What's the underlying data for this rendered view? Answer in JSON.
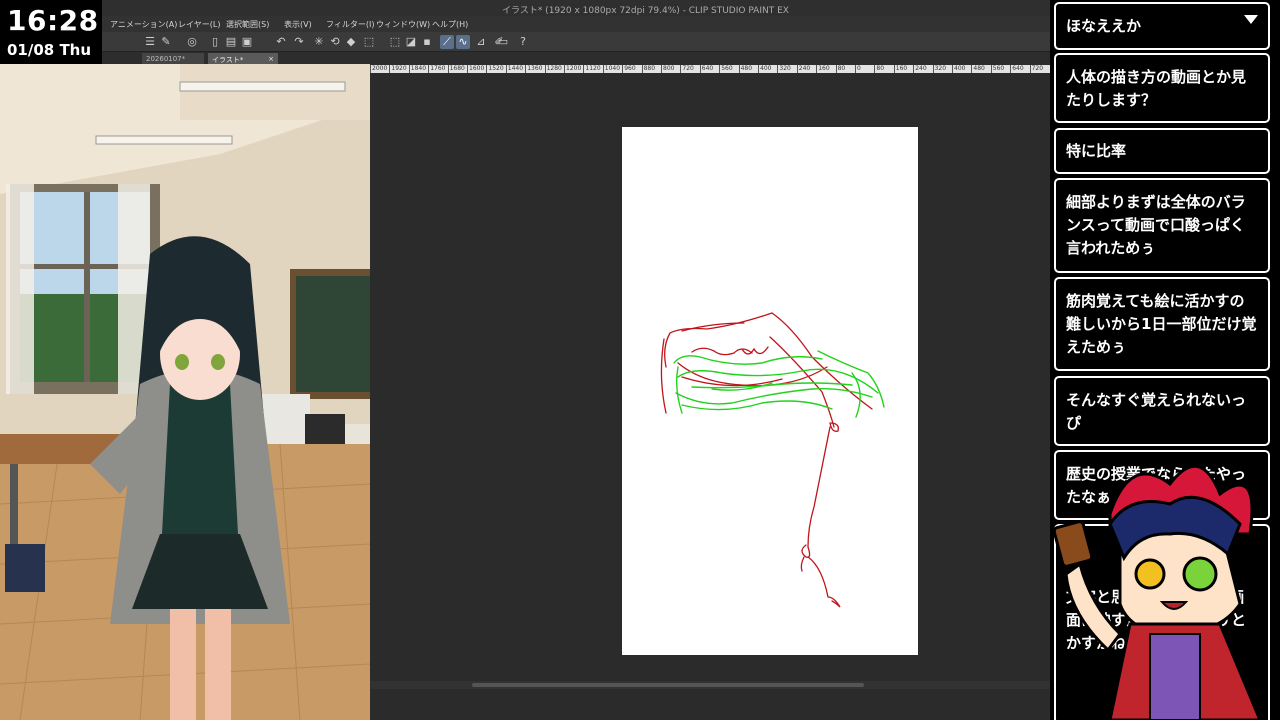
{
  "clock": {
    "time": "16:28",
    "date": "01/08 Thu"
  },
  "app": {
    "title": "イラスト* (1920 x 1080px 72dpi 79.4%)  - CLIP STUDIO PAINT EX",
    "menu": [
      "アニメーション(A)",
      "レイヤー(L)",
      "選択範囲(S)",
      "表示(V)",
      "フィルター(I)",
      "ウィンドウ(W)",
      "ヘルプ(H)"
    ],
    "tabs": [
      "20260107*",
      "イラスト*"
    ],
    "tab_close": "×"
  },
  "toolbar": {
    "icons": [
      "menu-icon",
      "new-icon",
      "open-icon",
      "save-icon",
      "undo-icon",
      "redo-icon",
      "transform-icon",
      "fill-icon",
      "pen-line-icon",
      "pen-curve-icon",
      "ruler-icon",
      "device-icon",
      "help-icon"
    ]
  },
  "ruler": {
    "labels": [
      "2000",
      "1920",
      "1840",
      "1760",
      "1680",
      "1600",
      "1520",
      "1440",
      "1360",
      "1280",
      "1200",
      "1120",
      "1040",
      "960",
      "880",
      "800",
      "720",
      "640",
      "560",
      "480",
      "400",
      "320",
      "240",
      "160",
      "80",
      "0",
      "80",
      "160",
      "240",
      "320",
      "400",
      "480",
      "560",
      "640",
      "720"
    ]
  },
  "chat": {
    "header": "ほなええか",
    "messages": [
      "人体の描き方の動画とか見たりします？",
      "特に比率",
      "細部よりまずは全体のバランスって動画で口酸っぱく言われためぅ",
      "筋肉覚えても絵に活かすの難しいから1日一部位だけ覚えためぅ",
      "そんなすぐ覚えられないっぴ",
      "歴史の授業でならったやったなぁ（笑）",
      "文字と思いきって描いて画面に映すだけで…アプリとかすかね"
    ]
  },
  "colors": {
    "sketch_red": "#c0141c",
    "sketch_green": "#22d21c",
    "chat_border": "#ffffff",
    "accent": "#5b6f8a"
  }
}
